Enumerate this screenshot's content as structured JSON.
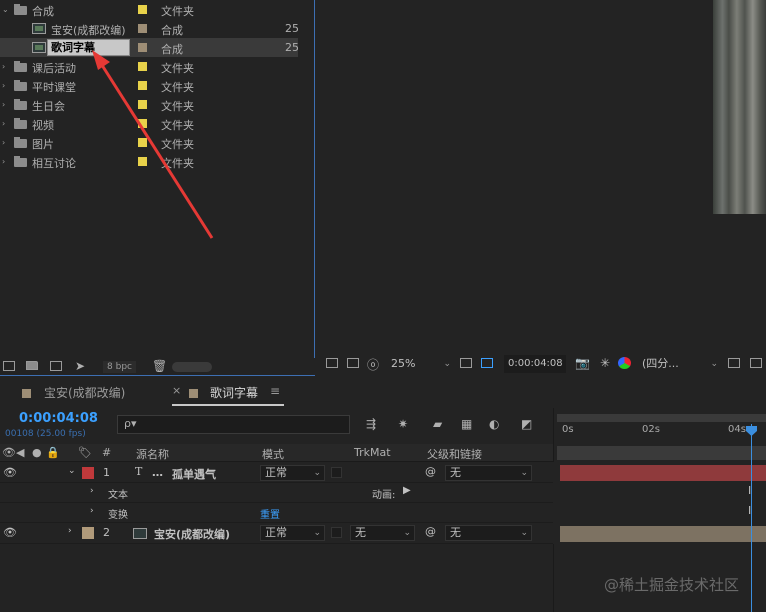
{
  "project": {
    "rows": [
      {
        "name": "合成",
        "type": "文件夹",
        "kind": "folder",
        "indent": 0,
        "open": true,
        "swatch": "#e8d24a",
        "frames": ""
      },
      {
        "name": "宝安(成都改编)",
        "type": "合成",
        "kind": "comp",
        "indent": 1,
        "open": false,
        "swatch": "#9e8e76",
        "frames": "25"
      },
      {
        "name": "歌词字幕",
        "type": "合成",
        "kind": "comp",
        "indent": 1,
        "open": false,
        "swatch": "#9e8e76",
        "frames": "25",
        "selected": true
      },
      {
        "name": "课后活动",
        "type": "文件夹",
        "kind": "folder",
        "indent": 0,
        "open": false,
        "swatch": "#e8d24a",
        "frames": ""
      },
      {
        "name": "平时课堂",
        "type": "文件夹",
        "kind": "folder",
        "indent": 0,
        "open": false,
        "swatch": "#e8d24a",
        "frames": ""
      },
      {
        "name": "生日会",
        "type": "文件夹",
        "kind": "folder",
        "indent": 0,
        "open": false,
        "swatch": "#e8d24a",
        "frames": ""
      },
      {
        "name": "视频",
        "type": "文件夹",
        "kind": "folder",
        "indent": 0,
        "open": false,
        "swatch": "#e8d24a",
        "frames": ""
      },
      {
        "name": "图片",
        "type": "文件夹",
        "kind": "folder",
        "indent": 0,
        "open": false,
        "swatch": "#e8d24a",
        "frames": ""
      },
      {
        "name": "相互讨论",
        "type": "文件夹",
        "kind": "folder",
        "indent": 0,
        "open": false,
        "swatch": "#e8d24a",
        "frames": ""
      }
    ],
    "footer": {
      "bpc": "8 bpc"
    }
  },
  "viewer": {
    "zoom": "25%",
    "timecode": "0:00:04:08",
    "resolution": "(四分...",
    "zoom_chev": "⌄",
    "res_chev": "⌄"
  },
  "tabs": [
    {
      "label": "宝安(成都改编)",
      "swatch": "#9e8e76",
      "active": false
    },
    {
      "label": "歌词字幕",
      "swatch": "#9e8e76",
      "active": true,
      "close": "×",
      "menu": "≡"
    }
  ],
  "timeline": {
    "timecode": "0:00:04:08",
    "frame_info": "00108 (25.00 fps)",
    "search_placeholder": "ρ▾",
    "columns": {
      "num": "#",
      "source": "源名称",
      "mode": "模式",
      "trkmat": "TrkMat",
      "parent": "父级和链接"
    },
    "layers": [
      {
        "num": "1",
        "name": "孤单遇气",
        "prefix": "T",
        "mode": "正常",
        "trkmat": "",
        "parent": "无",
        "color": "#c0393b",
        "expanded": true
      },
      {
        "num": "2",
        "name": "宝安(成都改编)",
        "prefix": "",
        "mode": "正常",
        "trkmat": "无",
        "parent": "无",
        "color": "#b09a7a",
        "expanded": false
      }
    ],
    "sub_rows": [
      {
        "label": "文本",
        "extra": "动画:"
      },
      {
        "label": "变换",
        "extra": "重置"
      }
    ],
    "ruler": [
      "0s",
      "02s",
      "04s"
    ]
  },
  "watermark": "@稀土掘金技术社区",
  "colors": {
    "accent": "#3ba0ff",
    "layer1_bar": "#8f3a3c",
    "layer2_bar": "#7d7262"
  }
}
